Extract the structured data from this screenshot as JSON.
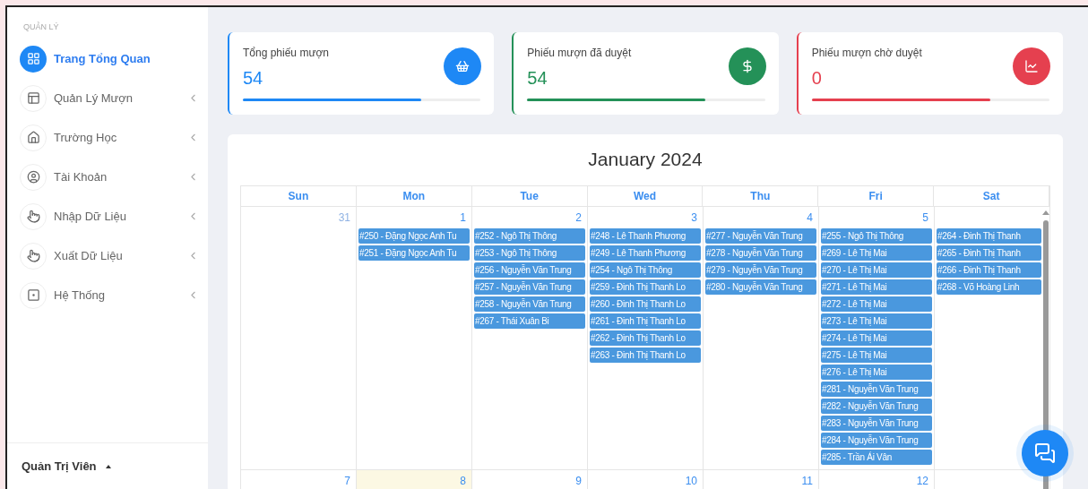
{
  "sidebar": {
    "section": "QUẢN LÝ",
    "items": [
      {
        "label": "Trang Tổng Quan",
        "selected": true,
        "expandable": false
      },
      {
        "label": "Quản Lý Mượn",
        "selected": false,
        "expandable": true
      },
      {
        "label": "Trường Học",
        "selected": false,
        "expandable": true
      },
      {
        "label": "Tài Khoản",
        "selected": false,
        "expandable": true
      },
      {
        "label": "Nhập Dữ Liệu",
        "selected": false,
        "expandable": true
      },
      {
        "label": "Xuất Dữ Liệu",
        "selected": false,
        "expandable": true
      },
      {
        "label": "Hệ Thống",
        "selected": false,
        "expandable": true
      }
    ],
    "user": "Quản Trị Viên"
  },
  "stats": [
    {
      "title": "Tổng phiếu mượn",
      "value": "54",
      "level": 0.75,
      "color": "#1e88f5"
    },
    {
      "title": "Phiếu mượn đã duyệt",
      "value": "54",
      "level": 0.75,
      "color": "#249158"
    },
    {
      "title": "Phiếu mượn chờ duyệt",
      "value": "0",
      "level": 0.75,
      "color": "#e5404f"
    }
  ],
  "calendar": {
    "title": "January 2024",
    "weekdays": [
      "Sun",
      "Mon",
      "Tue",
      "Wed",
      "Thu",
      "Fri",
      "Sat"
    ],
    "weeks": [
      {
        "days": [
          {
            "date": "31",
            "muted": true,
            "today": false
          },
          {
            "date": "1",
            "muted": false,
            "today": false,
            "events": [
              "#250 - Đặng Ngọc Anh Tu",
              "#251 - Đặng Ngọc Anh Tu"
            ]
          },
          {
            "date": "2",
            "muted": false,
            "today": false,
            "events": [
              "#252 - Ngô Thị Thông",
              "#253 - Ngô Thị Thông",
              "#256 - Nguyễn Văn Trung",
              "#257 - Nguyễn Văn Trung",
              "#258 - Nguyễn Văn Trung",
              "#267 - Thái Xuân Bi"
            ]
          },
          {
            "date": "3",
            "muted": false,
            "today": false,
            "events": [
              "#248 - Lê Thanh Phương",
              "#249 - Lê Thanh Phương",
              "#254 - Ngô Thị Thông",
              "#259 - Đinh Thị Thanh Lo",
              "#260 - Đinh Thị Thanh Lo",
              "#261 - Đinh Thị Thanh Lo",
              "#262 - Đinh Thị Thanh Lo",
              "#263 - Đinh Thị Thanh Lo"
            ]
          },
          {
            "date": "4",
            "muted": false,
            "today": false,
            "events": [
              "#277 - Nguyễn Văn Trung",
              "#278 - Nguyễn Văn Trung",
              "#279 - Nguyễn Văn Trung",
              "#280 - Nguyễn Văn Trung"
            ]
          },
          {
            "date": "5",
            "muted": false,
            "today": false,
            "events": [
              "#255 - Ngô Thị Thông",
              "#269 - Lê Thị Mai",
              "#270 - Lê Thị Mai",
              "#271 - Lê Thị Mai",
              "#272 - Lê Thị Mai",
              "#273 - Lê Thị Mai",
              "#274 - Lê Thị Mai",
              "#275 - Lê Thị Mai",
              "#276 - Lê Thị Mai",
              "#281 - Nguyễn Văn Trung",
              "#282 - Nguyễn Văn Trung",
              "#283 - Nguyễn Văn Trung",
              "#284 - Nguyễn Văn Trung",
              "#285 - Trần Ái Vân"
            ]
          },
          {
            "today": false,
            "events": [
              "#264 - Đinh Thị Thanh",
              "#265 - Đinh Thị Thanh",
              "#266 - Đinh Thị Thanh",
              "#268 - Võ Hoàng Linh"
            ]
          }
        ]
      },
      {
        "days": [
          {
            "date": "7",
            "today": false
          },
          {
            "date": "8",
            "today": true
          },
          {
            "date": "9",
            "today": false
          },
          {
            "date": "10",
            "today": false
          },
          {
            "date": "11",
            "today": false
          },
          {
            "date": "12",
            "today": false
          },
          {
            "today": false
          }
        ]
      }
    ]
  }
}
